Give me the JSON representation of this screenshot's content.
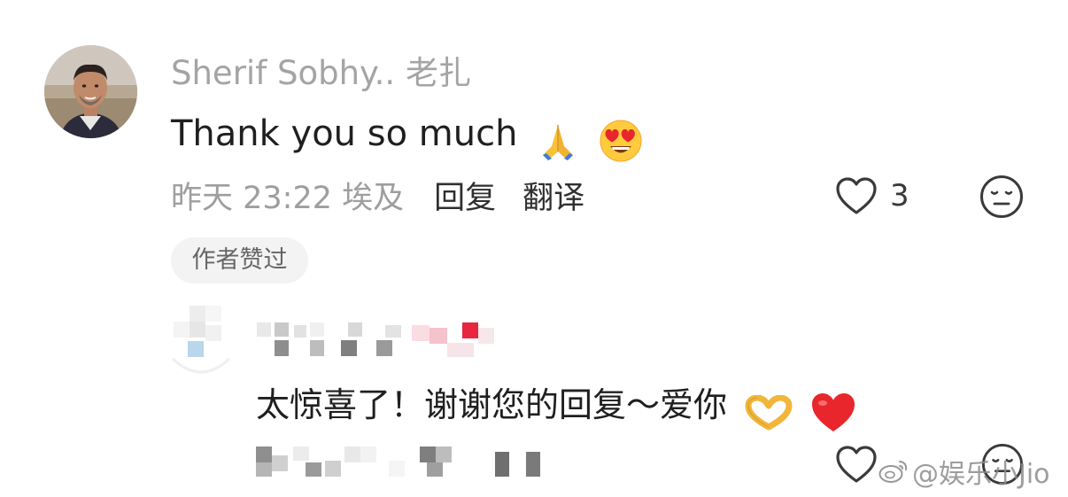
{
  "comment": {
    "username": "Sherif Sobhy.. 老扎",
    "text": "Thank you so much",
    "emojis": [
      "folded-hands-emoji",
      "heart-eyes-emoji"
    ],
    "timestamp": "昨天 23:22 埃及",
    "reply_label": "回复",
    "translate_label": "翻译",
    "like_count": "3",
    "author_liked_badge": "作者赞过"
  },
  "reply": {
    "username_censored": true,
    "text": "太惊喜了！谢谢您的回复～爱你",
    "emojis": [
      "heart-hands-emoji",
      "red-heart-emoji"
    ]
  },
  "watermark": {
    "text": "@娱乐小Jio",
    "icon": "weibo-logo"
  },
  "colors": {
    "meta_gray": "#9e9e9e",
    "username_gray": "#a4a4a4",
    "badge_bg": "#f3f3f3",
    "heart_red": "#e8262c"
  }
}
